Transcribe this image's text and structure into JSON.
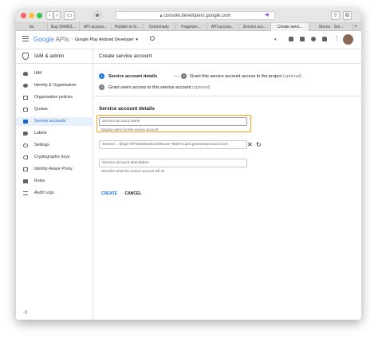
{
  "browser": {
    "url": "console.developers.google.com",
    "tabs": [
      {
        "label": "da",
        "active": false
      },
      {
        "label": "Bug 594001...",
        "active": false
      },
      {
        "label": "API access...",
        "active": false
      },
      {
        "label": "Publish to G...",
        "active": false
      },
      {
        "label": "Grammarly",
        "active": false
      },
      {
        "label": "Fragmen...",
        "active": false
      },
      {
        "label": "API access...",
        "active": false
      },
      {
        "label": "Service acc...",
        "active": false
      },
      {
        "label": "Create servi...",
        "active": true
      },
      {
        "label": "Stores - Sm...",
        "active": false
      }
    ]
  },
  "appbar": {
    "logo_google": "Google",
    "logo_apis": "APIs",
    "project": "Google Play Android Developer"
  },
  "sidebar": {
    "title": "IAM & admin",
    "items": [
      {
        "label": "IAM",
        "active": false
      },
      {
        "label": "Identity & Organisation",
        "active": false
      },
      {
        "label": "Organisation policies",
        "active": false
      },
      {
        "label": "Quotas",
        "active": false
      },
      {
        "label": "Service accounts",
        "active": true
      },
      {
        "label": "Labels",
        "active": false
      },
      {
        "label": "Settings",
        "active": false
      },
      {
        "label": "Cryptographic keys",
        "active": false
      },
      {
        "label": "Identity-Aware Proxy",
        "active": false
      },
      {
        "label": "Roles",
        "active": false
      },
      {
        "label": "Audit Logs",
        "active": false
      }
    ],
    "collapse": "◁|"
  },
  "main": {
    "title": "Create service account",
    "steps": [
      {
        "num": "1",
        "label": "Service account details",
        "optional": ""
      },
      {
        "num": "2",
        "label": "Grant this service account access to the project",
        "optional": "(optional)"
      },
      {
        "num": "3",
        "label": "Grant users access to this service account",
        "optional": "(optional)"
      }
    ],
    "section_title": "Service account details",
    "name_field": {
      "placeholder": "Service account name",
      "help": "Display name for this service account"
    },
    "id_field": {
      "prefix": "Service...",
      "suffix": "@api-7976831618413465116-755572.iam.gserviceaccount.com"
    },
    "desc_field": {
      "placeholder": "Service account description",
      "help": "Describe what this service account will do"
    },
    "create_label": "CREATE",
    "cancel_label": "CANCEL"
  }
}
